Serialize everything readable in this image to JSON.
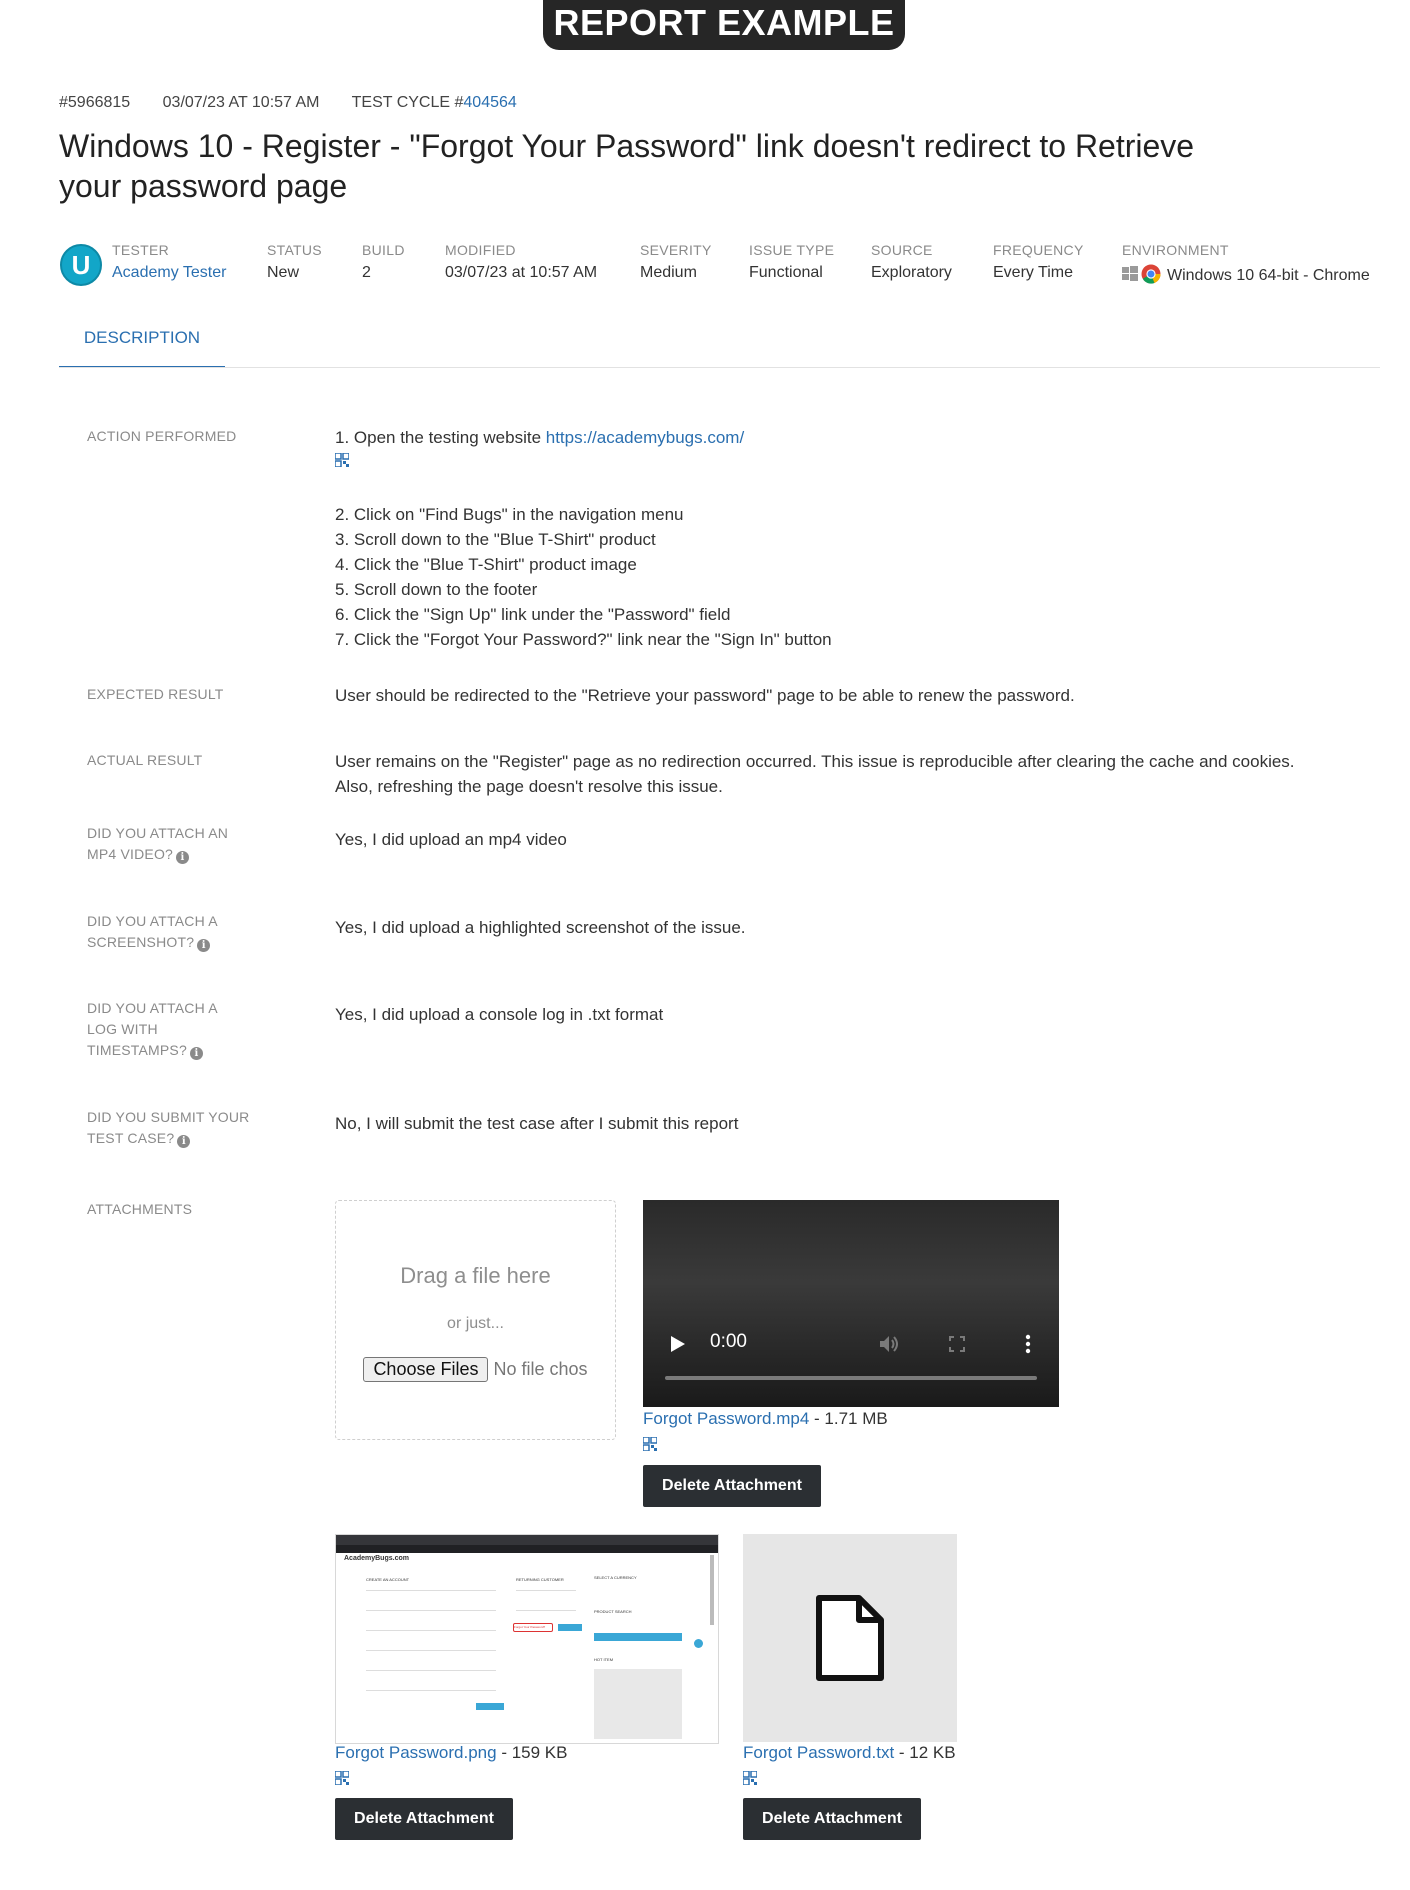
{
  "banner": "REPORT EXAMPLE",
  "meta": {
    "id": "#5966815",
    "date": "03/07/23 AT 10:57 AM",
    "cycle_label": "TEST CYCLE #",
    "cycle_number": "404564"
  },
  "title": "Windows 10 - Register - \"Forgot Your Password\" link doesn't redirect to Retrieve your password page",
  "avatar_letter": "U",
  "fields": {
    "tester": {
      "label": "TESTER",
      "value": "Academy Tester"
    },
    "status": {
      "label": "STATUS",
      "value": "New"
    },
    "build": {
      "label": "BUILD",
      "value": "2"
    },
    "modified": {
      "label": "MODIFIED",
      "value": "03/07/23 at 10:57 AM"
    },
    "severity": {
      "label": "SEVERITY",
      "value": "Medium"
    },
    "issue_type": {
      "label": "ISSUE TYPE",
      "value": "Functional"
    },
    "source": {
      "label": "SOURCE",
      "value": "Exploratory"
    },
    "frequency": {
      "label": "FREQUENCY",
      "value": "Every Time"
    },
    "environment": {
      "label": "ENVIRONMENT",
      "value": "Windows 10 64-bit - Chrome"
    }
  },
  "tab": "DESCRIPTION",
  "sections": {
    "action": {
      "label": "ACTION PERFORMED",
      "step1_prefix": "1. Open the testing website ",
      "step1_link": "https://academybugs.com/",
      "steps": [
        "2. Click on \"Find Bugs\" in the navigation menu",
        "3. Scroll down to the \"Blue T-Shirt\" product",
        "4. Click the \"Blue T-Shirt\" product image",
        "5. Scroll down to the footer",
        "6. Click the \"Sign Up\" link under the \"Password\" field",
        "7. Click the \"Forgot Your Password?\" link near the \"Sign In\" button"
      ]
    },
    "expected": {
      "label": "EXPECTED RESULT",
      "value": "User should be redirected to the \"Retrieve your password\" page to be able to renew the password."
    },
    "actual": {
      "label": "ACTUAL RESULT",
      "line1": "User remains on the \"Register\" page as no redirection occurred. This issue is reproducible after clearing the cache and cookies.",
      "line2": "Also, refreshing the page doesn't resolve this issue."
    },
    "video_q": {
      "label_1": "DID YOU ATTACH AN",
      "label_2": "MP4 VIDEO?",
      "value": "Yes, I did upload an mp4 video"
    },
    "screenshot_q": {
      "label_1": "DID YOU ATTACH A",
      "label_2": "SCREENSHOT?",
      "value": "Yes, I did upload a highlighted screenshot of the issue."
    },
    "log_q": {
      "label_1": "DID YOU ATTACH A",
      "label_2": "LOG WITH",
      "label_3": "TIMESTAMPS?",
      "value": "Yes, I did upload a console log in .txt format"
    },
    "testcase_q": {
      "label_1": "DID YOU SUBMIT YOUR",
      "label_2": "TEST CASE?",
      "value": "No, I will submit the test case after I submit this report"
    },
    "attachments": {
      "label": "ATTACHMENTS"
    }
  },
  "dropzone": {
    "drag": "Drag a file here",
    "or_just": "or just...",
    "choose": "Choose Files",
    "no_file": "No file chos"
  },
  "video_player": {
    "time": "0:00"
  },
  "attachments": [
    {
      "name": "Forgot Password.mp4",
      "size": " - 1.71 MB",
      "delete": "Delete Attachment"
    },
    {
      "name": "Forgot Password.png",
      "size": " - 159 KB",
      "delete": "Delete Attachment"
    },
    {
      "name": "Forgot Password.txt",
      "size": " - 12 KB",
      "delete": "Delete Attachment"
    }
  ],
  "screenshot_thumb": {
    "site_name": "AcademyBugs.com",
    "create_account": "CREATE AN ACCOUNT",
    "returning": "RETURNING CUSTOMER",
    "currency": "SELECT A CURRENCY",
    "search": "PRODUCT SEARCH",
    "hot_item": "HOT ITEM",
    "forgot_link": "Forgot Your Password?"
  },
  "colors": {
    "accent": "#2a6fb0",
    "avatar": "#12a6c8",
    "button": "#2b2f33",
    "banner": "#262626"
  }
}
